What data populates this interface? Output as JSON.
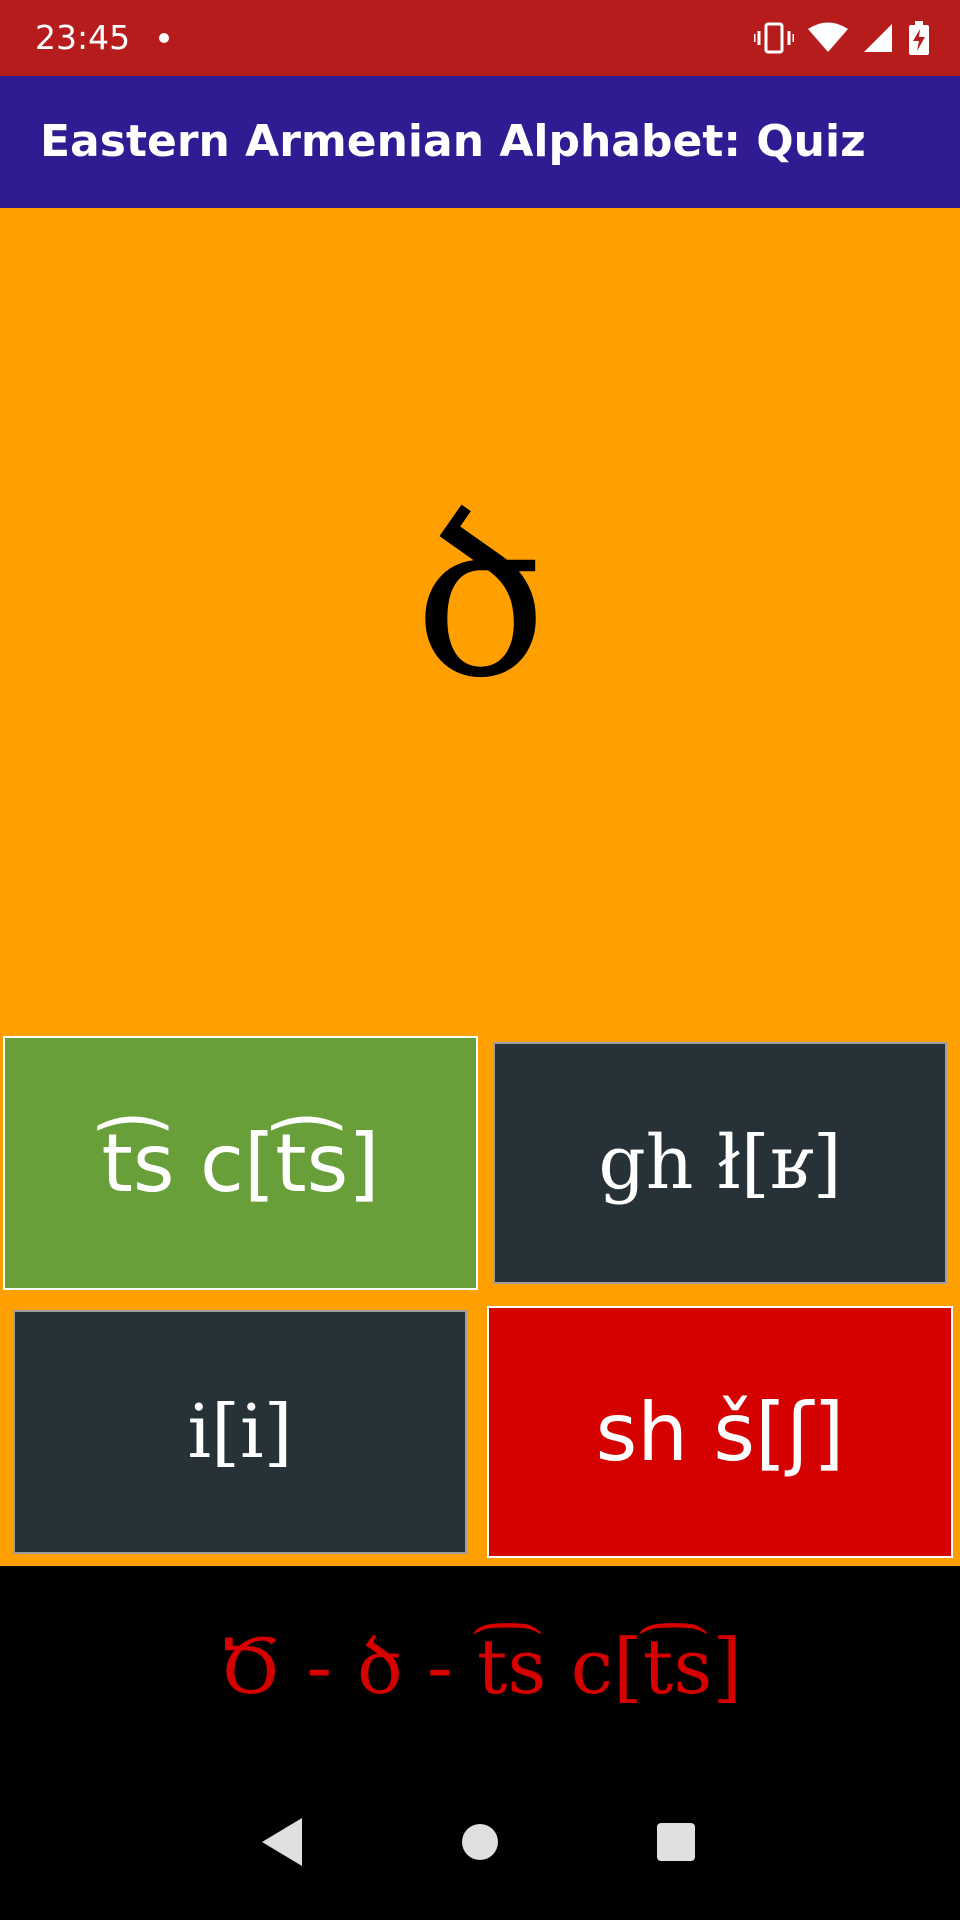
{
  "status_bar": {
    "time": "23:45",
    "icons": [
      "notification-dot-icon",
      "vibrate-icon",
      "wifi-icon",
      "signal-icon",
      "battery-charging-icon"
    ],
    "background": "#b71c1c"
  },
  "app_bar": {
    "title": "Eastern Armenian Alphabet: Quiz",
    "background": "#311b92"
  },
  "quiz": {
    "background": "#ffa000",
    "letter": "ծ",
    "answers": [
      {
        "label": "t͡s c[t͡s]",
        "state": "correct",
        "color": "#689f38"
      },
      {
        "label": "gh ł[ʁ]",
        "state": "neutral",
        "color": "#263238"
      },
      {
        "label": "i[i]",
        "state": "neutral",
        "color": "#263238"
      },
      {
        "label": "sh š[ʃ]",
        "state": "wrong",
        "color": "#d50000"
      }
    ]
  },
  "feedback": {
    "text": "Ծ - ծ - t͡s c[t͡s]",
    "color": "#d50000"
  },
  "nav_bar": {
    "buttons": [
      "back-icon",
      "home-icon",
      "recents-icon"
    ]
  }
}
